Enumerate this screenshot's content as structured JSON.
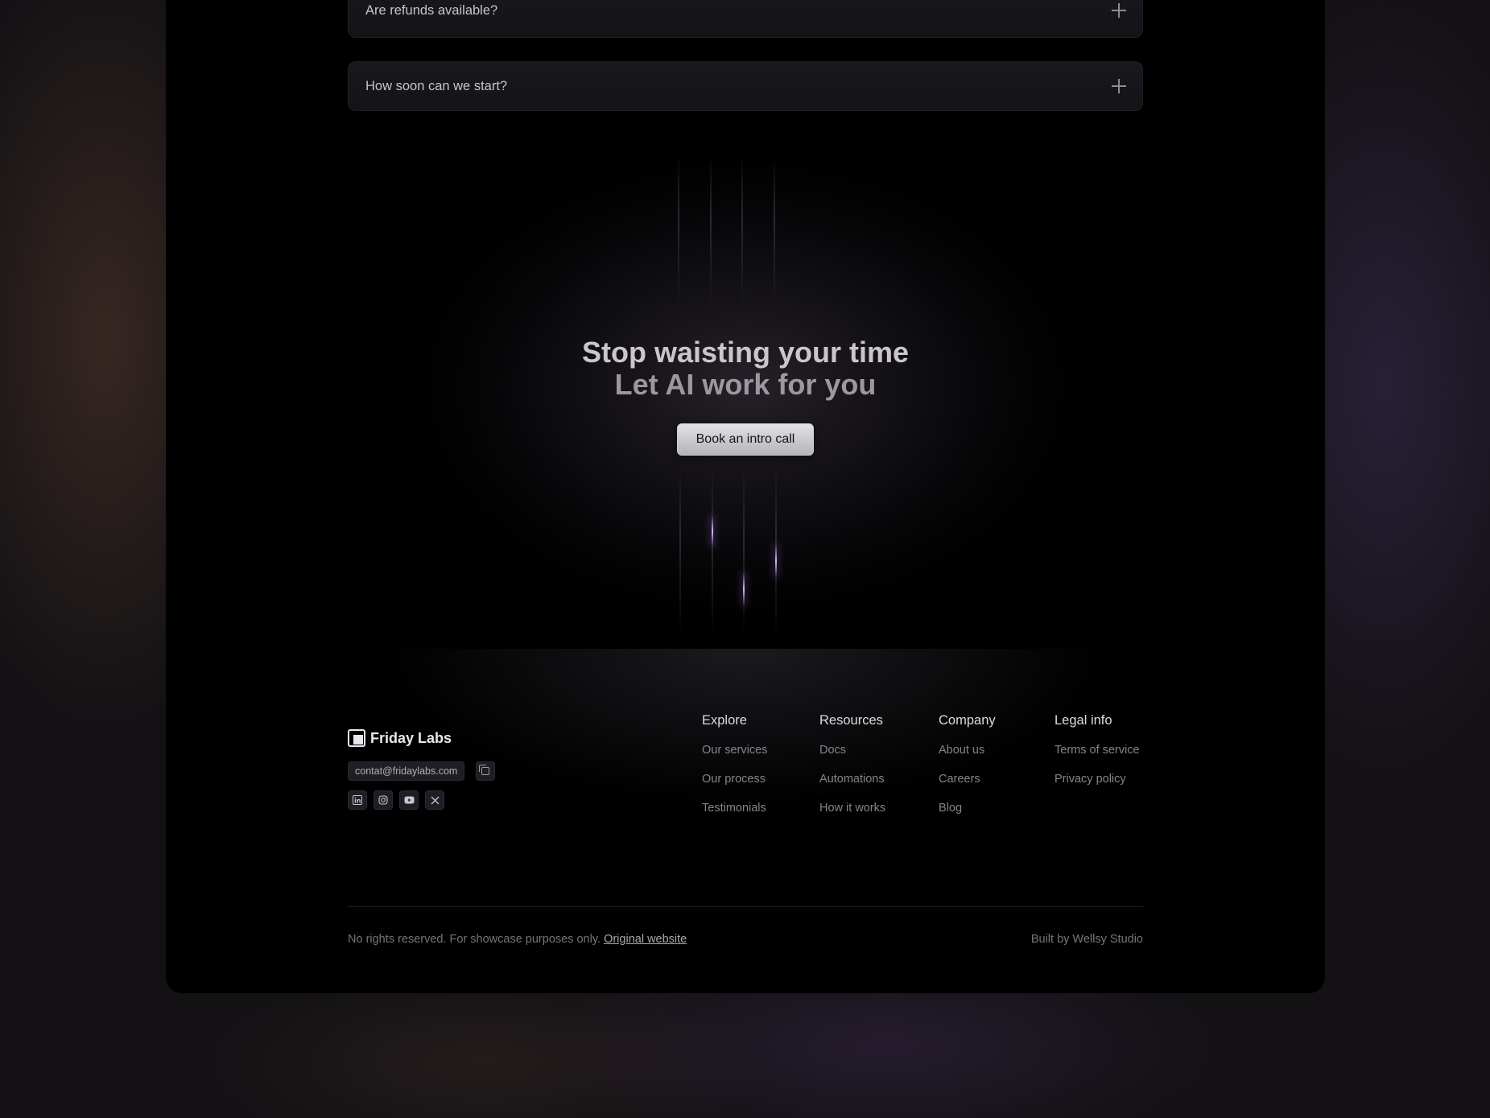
{
  "faq": {
    "items": [
      {
        "question": "Are refunds available?"
      },
      {
        "question": "How soon can we start?"
      }
    ]
  },
  "cta": {
    "title_line1": "Stop waisting your time",
    "title_line2": "Let AI work for you",
    "button_label": "Book an intro call"
  },
  "footer": {
    "brand_name": "Friday Labs",
    "email": "contat@fridaylabs.com",
    "social_icons": [
      "linkedin-icon",
      "instagram-icon",
      "youtube-icon",
      "x-icon"
    ],
    "columns": [
      {
        "heading": "Explore",
        "links": [
          "Our services",
          "Our process",
          "Testimonials"
        ]
      },
      {
        "heading": "Resources",
        "links": [
          "Docs",
          "Automations",
          "How it works"
        ]
      },
      {
        "heading": "Company",
        "links": [
          "About us",
          "Careers",
          "Blog"
        ]
      },
      {
        "heading": "Legal info",
        "links": [
          "Terms of service",
          "Privacy policy"
        ]
      }
    ],
    "bottom_text": "No rights reserved. For showcase purposes only.",
    "bottom_link": "Original website",
    "built_by": "Built by Wellsy Studio"
  }
}
